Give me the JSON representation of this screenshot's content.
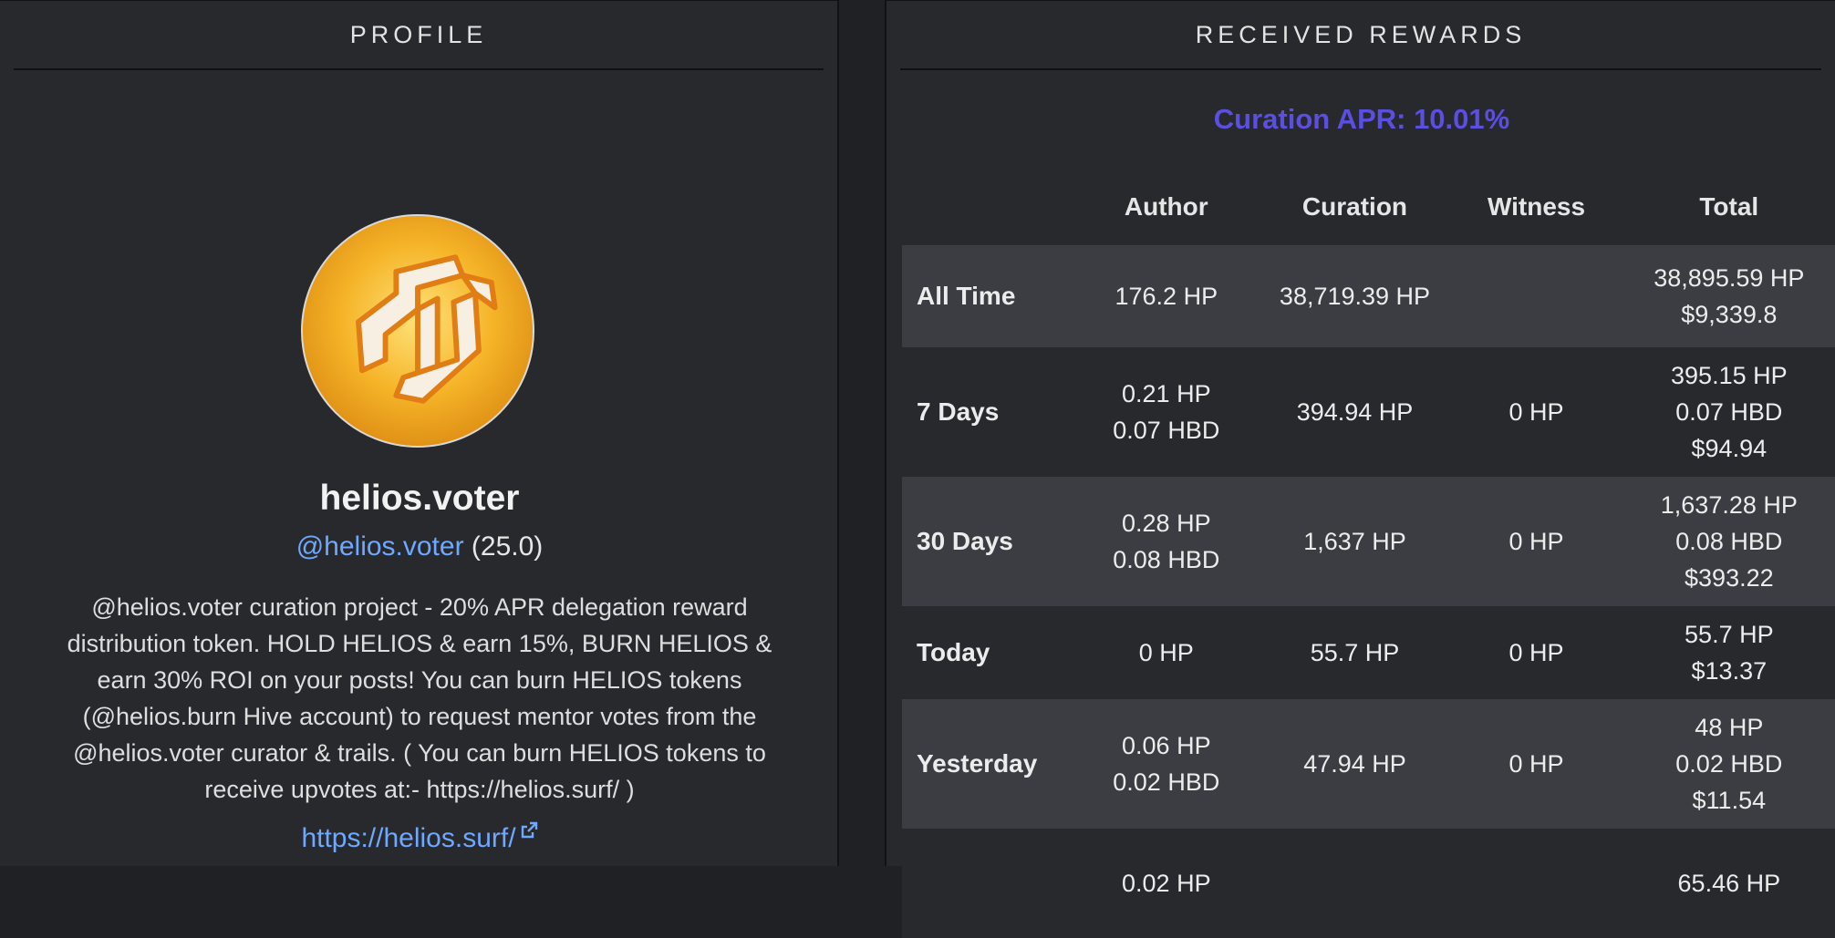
{
  "profile": {
    "header": "PROFILE",
    "name": "helios.voter",
    "handle": "@helios.voter",
    "reputation": "(25.0)",
    "bio": "@helios.voter curation project - 20% APR delegation reward distribution token. HOLD HELIOS & earn 15%, BURN HELIOS & earn 30% ROI on your posts! You can burn HELIOS tokens (@helios.burn Hive account) to request mentor votes from the @helios.voter curator & trails. ( You can burn HELIOS tokens to receive upvotes at:- https://helios.surf/ )",
    "website": "https://helios.surf/",
    "avatar_icon": "helios-logo-icon",
    "link_color": "#6fa8ff"
  },
  "rewards": {
    "header": "RECEIVED REWARDS",
    "apr": "Curation APR: 10.01%",
    "apr_color": "#5a4fe0",
    "columns": [
      "",
      "Author",
      "Curation",
      "Witness",
      "Total"
    ],
    "rows": [
      {
        "label": "All Time",
        "author": [
          "176.2 HP"
        ],
        "curation": [
          "38,719.39 HP"
        ],
        "witness": [],
        "total": [
          "38,895.59 HP",
          "$9,339.8"
        ]
      },
      {
        "label": "7 Days",
        "author": [
          "0.21 HP",
          "0.07 HBD"
        ],
        "curation": [
          "394.94 HP"
        ],
        "witness": [
          "0 HP"
        ],
        "total": [
          "395.15 HP",
          "0.07 HBD",
          "$94.94"
        ]
      },
      {
        "label": "30 Days",
        "author": [
          "0.28 HP",
          "0.08 HBD"
        ],
        "curation": [
          "1,637 HP"
        ],
        "witness": [
          "0 HP"
        ],
        "total": [
          "1,637.28 HP",
          "0.08 HBD",
          "$393.22"
        ]
      },
      {
        "label": "Today",
        "author": [
          "0 HP"
        ],
        "curation": [
          "55.7 HP"
        ],
        "witness": [
          "0 HP"
        ],
        "total": [
          "55.7 HP",
          "$13.37"
        ]
      },
      {
        "label": "Yesterday",
        "author": [
          "0.06 HP",
          "0.02 HBD"
        ],
        "curation": [
          "47.94 HP"
        ],
        "witness": [
          "0 HP"
        ],
        "total": [
          "48 HP",
          "0.02 HBD",
          "$11.54"
        ]
      },
      {
        "label": "",
        "author": [
          "0.02 HP"
        ],
        "curation": [],
        "witness": [],
        "total": [
          "65.46 HP"
        ]
      }
    ]
  }
}
